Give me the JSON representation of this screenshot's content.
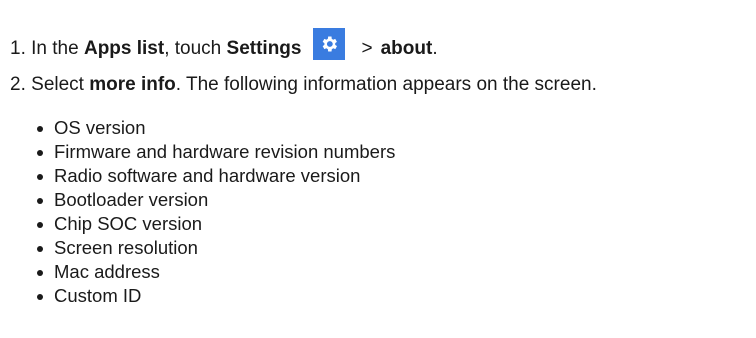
{
  "steps": [
    {
      "number": "1.",
      "text_1": "In the ",
      "bold_1": "Apps list",
      "text_2": ", touch ",
      "bold_2": "Settings",
      "icon": "settings-gear-icon",
      "separator": ">",
      "bold_3": "about",
      "text_3": "."
    },
    {
      "number": "2.",
      "text_1": "Select ",
      "bold_1": "more info",
      "text_2": ". The following information appears on the screen."
    }
  ],
  "info_items": [
    "OS version",
    "Firmware and hardware revision numbers",
    "Radio software and hardware version",
    "Bootloader version",
    "Chip SOC version",
    "Screen resolution",
    "Mac address",
    "Custom ID"
  ],
  "colors": {
    "text": "#1a1a1a",
    "settings_icon_bg": "#3a7ce0"
  }
}
